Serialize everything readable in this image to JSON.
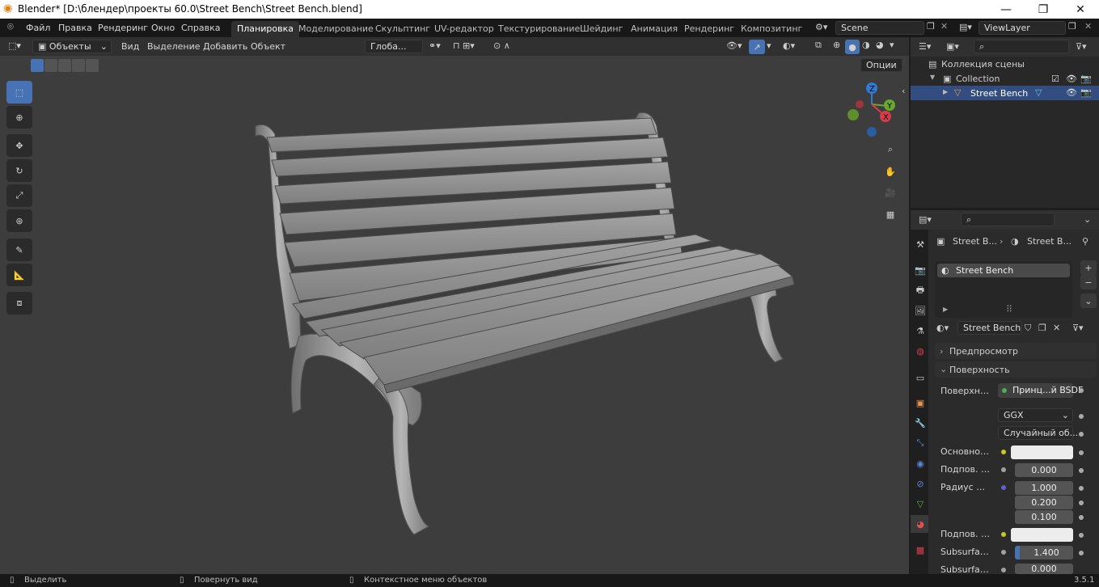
{
  "window": {
    "title": "Blender* [D:\\блендер\\проекты 60.0\\Street Bench\\Street Bench.blend]",
    "minimize": "—",
    "maximize": "❐",
    "close": "✕"
  },
  "topbar": {
    "menus": [
      "Файл",
      "Правка",
      "Рендеринг",
      "Окно",
      "Справка"
    ],
    "workspaces": [
      "Планировка",
      "Моделирование",
      "Скульптинг",
      "UV-редактор",
      "Текстурирование",
      "Шейдинг",
      "Анимация",
      "Рендеринг",
      "Композитинг"
    ],
    "active_workspace": "Планировка",
    "scene": "Scene",
    "view_layer": "ViewLayer"
  },
  "viewport_header": {
    "mode": "Объекты",
    "menus": [
      "Вид",
      "Выделение",
      "Добавить",
      "Объект"
    ],
    "transform_orientation": "Глоба...",
    "options": "Опции"
  },
  "outliner": {
    "scene_collection": "Коллекция сцены",
    "collection": "Collection",
    "object": "Street Bench"
  },
  "properties": {
    "breadcrumb_object": "Street B...",
    "breadcrumb_material": "Street B...",
    "material_slot": "Street Bench",
    "material_name": "Street Bench",
    "panel_preview": "Предпросмотр",
    "panel_surface": "Поверхность",
    "surface_label": "Поверхность",
    "surface_value": "Принц...й BSDF",
    "distribution": "GGX",
    "subsurface_method": "Случайный об...",
    "base_color_label": "Основной ...",
    "subsurface_label": "Подпов. р...",
    "subsurface_value": "0.000",
    "radius_label": "Радиус по...",
    "radius_x": "1.000",
    "radius_y": "0.200",
    "radius_z": "0.100",
    "subsurface_color_label": "Подпов. цв...",
    "subsurface_ior_label": "Subsurfac...",
    "subsurface_ior_value": "1.400",
    "subsurface_aniso_label": "Subsurfac...",
    "subsurface_aniso_value": "0.000"
  },
  "status": {
    "select": "Выделить",
    "rotate": "Повернуть вид",
    "context_menu": "Контекстное меню объектов",
    "version": "3.5.1"
  },
  "colors": {
    "accent": "#4772b3",
    "viewport_bg": "#3d3d3d",
    "selection_row": "#334d80",
    "mesh": "#8f8f8f"
  }
}
